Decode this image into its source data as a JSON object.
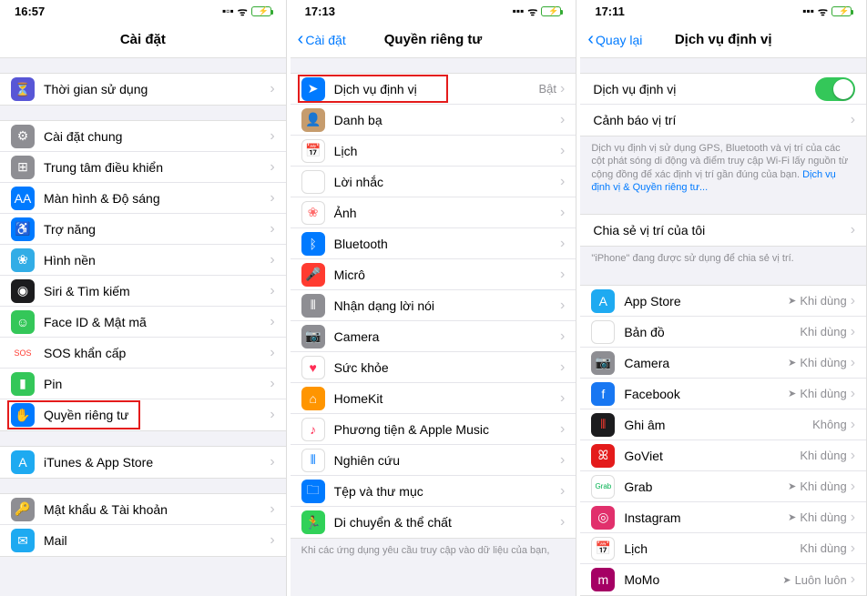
{
  "phone1": {
    "time": "16:57",
    "navTitle": "Cài đặt",
    "g1": [
      {
        "label": "Thời gian sử dụng",
        "iconBg": "#5856d6",
        "glyph": "⏳"
      }
    ],
    "g2": [
      {
        "label": "Cài đặt chung",
        "iconBg": "#8e8e93",
        "glyph": "⚙"
      },
      {
        "label": "Trung tâm điều khiển",
        "iconBg": "#8e8e93",
        "glyph": "⊞"
      },
      {
        "label": "Màn hình & Độ sáng",
        "iconBg": "#007aff",
        "glyph": "AA"
      },
      {
        "label": "Trợ năng",
        "iconBg": "#007aff",
        "glyph": "♿"
      },
      {
        "label": "Hình nền",
        "iconBg": "#32ade6",
        "glyph": "❀"
      },
      {
        "label": "Siri & Tìm kiếm",
        "iconBg": "#1c1c1e",
        "glyph": "◉"
      },
      {
        "label": "Face ID & Mật mã",
        "iconBg": "#34c759",
        "glyph": "☺"
      },
      {
        "label": "SOS khẩn cấp",
        "iconBg": "#ffffff",
        "glyph": "SOS",
        "glyphColor": "#ff3b30"
      },
      {
        "label": "Pin",
        "iconBg": "#34c759",
        "glyph": "▮"
      },
      {
        "label": "Quyền riêng tư",
        "iconBg": "#007aff",
        "glyph": "✋",
        "hl": true
      }
    ],
    "g3": [
      {
        "label": "iTunes & App Store",
        "iconBg": "#1eaaf1",
        "glyph": "A"
      }
    ],
    "g4": [
      {
        "label": "Mật khẩu & Tài khoản",
        "iconBg": "#8e8e93",
        "glyph": "🔑"
      },
      {
        "label": "Mail",
        "iconBg": "#1eaaf1",
        "glyph": "✉"
      }
    ]
  },
  "phone2": {
    "time": "17:13",
    "backLabel": "Cài đặt",
    "navTitle": "Quyền riêng tư",
    "rows": [
      {
        "label": "Dịch vụ định vị",
        "iconBg": "#007aff",
        "glyph": "➤",
        "val": "Bật",
        "hl": true
      },
      {
        "label": "Danh bạ",
        "iconBg": "#c69c6d",
        "glyph": "👤"
      },
      {
        "label": "Lịch",
        "iconBg": "#ffffff",
        "glyph": "📅",
        "border": true
      },
      {
        "label": "Lời nhắc",
        "iconBg": "#ffffff",
        "glyph": "☰",
        "border": true
      },
      {
        "label": "Ảnh",
        "iconBg": "#ffffff",
        "glyph": "❀",
        "glyphColor": "#ff6b6b",
        "border": true
      },
      {
        "label": "Bluetooth",
        "iconBg": "#007aff",
        "glyph": "ᛒ"
      },
      {
        "label": "Micrô",
        "iconBg": "#ff3b30",
        "glyph": "🎤"
      },
      {
        "label": "Nhận dạng lời nói",
        "iconBg": "#8e8e93",
        "glyph": "⦀"
      },
      {
        "label": "Camera",
        "iconBg": "#8e8e93",
        "glyph": "📷"
      },
      {
        "label": "Sức khỏe",
        "iconBg": "#ffffff",
        "glyph": "♥",
        "glyphColor": "#ff2d55",
        "border": true
      },
      {
        "label": "HomeKit",
        "iconBg": "#ff9500",
        "glyph": "⌂"
      },
      {
        "label": "Phương tiện & Apple Music",
        "iconBg": "#ffffff",
        "glyph": "♪",
        "glyphColor": "#ff2d55",
        "border": true
      },
      {
        "label": "Nghiên cứu",
        "iconBg": "#ffffff",
        "glyph": "⦀",
        "glyphColor": "#007aff",
        "border": true
      },
      {
        "label": "Tệp và thư mục",
        "iconBg": "#007aff",
        "glyph": "🗀"
      },
      {
        "label": "Di chuyển & thể chất",
        "iconBg": "#30d158",
        "glyph": "🏃"
      }
    ],
    "footer": "Khi các ứng dụng yêu cầu truy cập vào dữ liệu của bạn,"
  },
  "phone3": {
    "time": "17:11",
    "backLabel": "Quay lại",
    "navTitle": "Dịch vụ định vị",
    "r1": {
      "label": "Dịch vụ định vị"
    },
    "r2": {
      "label": "Cảnh báo vị trí"
    },
    "note": "Dịch vụ định vị sử dụng GPS, Bluetooth và vị trí của các cột phát sóng di động và điểm truy cập Wi-Fi lấy nguồn từ cộng đồng để xác định vị trí gần đúng của bạn. ",
    "noteLink": "Dịch vụ định vị & Quyền riêng tư...",
    "r3": {
      "label": "Chia sẻ vị trí của tôi"
    },
    "shareNote": "\"iPhone\" đang được sử dụng để chia sẻ vị trí.",
    "apps": [
      {
        "label": "App Store",
        "iconBg": "#1eaaf1",
        "glyph": "A",
        "val": "Khi dùng",
        "arrow": true
      },
      {
        "label": "Bản đồ",
        "iconBg": "#ffffff",
        "glyph": "🗺",
        "border": true,
        "val": "Khi dùng"
      },
      {
        "label": "Camera",
        "iconBg": "#8e8e93",
        "glyph": "📷",
        "val": "Khi dùng",
        "arrow": true
      },
      {
        "label": "Facebook",
        "iconBg": "#1877f2",
        "glyph": "f",
        "val": "Khi dùng",
        "arrow": true
      },
      {
        "label": "Ghi âm",
        "iconBg": "#1c1c1e",
        "glyph": "⦀",
        "glyphColor": "#ff3b30",
        "val": "Không"
      },
      {
        "label": "GoViet",
        "iconBg": "#e41b1b",
        "glyph": "ꕤ",
        "val": "Khi dùng"
      },
      {
        "label": "Grab",
        "iconBg": "#ffffff",
        "glyph": "Grab",
        "glyphColor": "#00b14f",
        "border": true,
        "val": "Khi dùng",
        "arrow": true,
        "small": true
      },
      {
        "label": "Instagram",
        "iconBg": "#e1306c",
        "glyph": "◎",
        "val": "Khi dùng",
        "arrow": true
      },
      {
        "label": "Lịch",
        "iconBg": "#ffffff",
        "glyph": "📅",
        "border": true,
        "val": "Khi dùng"
      },
      {
        "label": "MoMo",
        "iconBg": "#a50064",
        "glyph": "m",
        "val": "Luôn luôn",
        "arrow": true
      }
    ]
  }
}
